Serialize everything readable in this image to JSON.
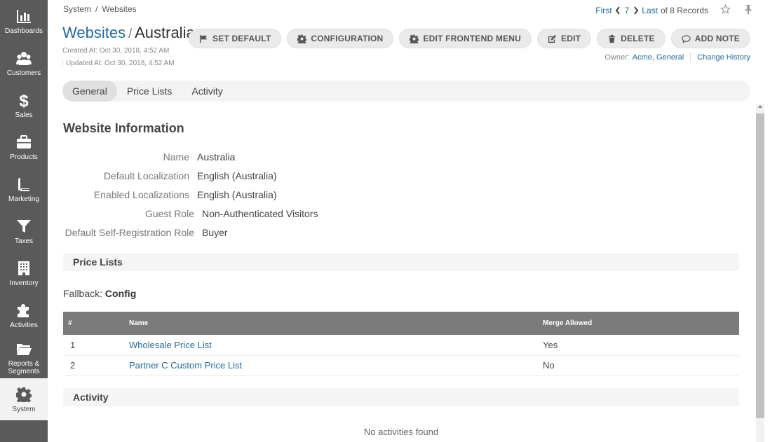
{
  "sidebar": {
    "items": [
      {
        "label": "Dashboards",
        "icon": "dashboards-icon"
      },
      {
        "label": "Customers",
        "icon": "customers-icon"
      },
      {
        "label": "Sales",
        "icon": "dollar-icon"
      },
      {
        "label": "Products",
        "icon": "briefcase-icon"
      },
      {
        "label": "Marketing",
        "icon": "book-icon"
      },
      {
        "label": "Taxes",
        "icon": "filter-icon"
      },
      {
        "label": "Inventory",
        "icon": "building-icon"
      },
      {
        "label": "Activities",
        "icon": "puzzle-icon"
      },
      {
        "label": "Reports & Segments",
        "icon": "folder-icon"
      },
      {
        "label": "System",
        "icon": "gear-icon"
      }
    ]
  },
  "breadcrumb": {
    "root": "System",
    "sep": "/",
    "current": "Websites"
  },
  "pager": {
    "first": "First",
    "current": "7",
    "last": "Last",
    "of_records": "of 8 Records"
  },
  "header": {
    "entity": "Websites",
    "slash": "/",
    "record": "Australia",
    "created": "Created At: Oct 30, 2018, 4:52 AM",
    "updated": "Updated At: Oct 30, 2018, 4:52 AM"
  },
  "actions": {
    "set_default": "SET DEFAULT",
    "configuration": "CONFIGURATION",
    "edit_menu": "EDIT FRONTEND MENU",
    "edit": "EDIT",
    "delete": "DELETE",
    "add_note": "ADD NOTE"
  },
  "owner": {
    "label": "Owner:",
    "value": "Acme, General",
    "history": "Change History"
  },
  "tabs": [
    "General",
    "Price Lists",
    "Activity"
  ],
  "info": {
    "title": "Website Information",
    "name_label": "Name",
    "name_value": "Australia",
    "default_loc_label": "Default Localization",
    "default_loc_value": "English (Australia)",
    "enabled_loc_label": "Enabled Localizations",
    "enabled_loc_value": "English (Australia)",
    "guest_role_label": "Guest Role",
    "guest_role_value": "Non-Authenticated Visitors",
    "self_reg_label": "Default Self-Registration Role",
    "self_reg_value": "Buyer"
  },
  "price_lists": {
    "title": "Price Lists",
    "fallback_label": "Fallback:",
    "fallback_value": "Config",
    "columns": [
      "#",
      "Name",
      "Merge Allowed"
    ],
    "rows": [
      {
        "num": "1",
        "name": "Wholesale Price List",
        "merge": "Yes"
      },
      {
        "num": "2",
        "name": "Partner C Custom Price List",
        "merge": "No"
      }
    ]
  },
  "activity": {
    "title": "Activity",
    "empty": "No activities found"
  }
}
